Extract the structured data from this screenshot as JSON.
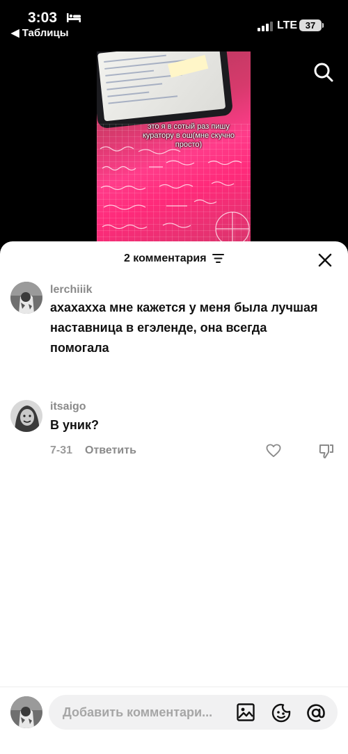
{
  "status_bar": {
    "time": "3:03",
    "back_app": "◀ Таблицы",
    "network": "LTE",
    "battery": "37"
  },
  "video": {
    "caption": "это я в сотый раз пишу куратору в ош(мне скучно просто)"
  },
  "comments_sheet": {
    "title": "2 комментария",
    "comments": [
      {
        "username": "lerchiiik",
        "text": "ахахахха мне кажется у меня была лучшая наставница в егэленде, она всегда помогала"
      },
      {
        "username": "itsaigo",
        "text": "В уник?",
        "date": "7-31",
        "reply_label": "Ответить"
      }
    ]
  },
  "composer": {
    "placeholder": "Добавить комментари..."
  },
  "colors": {
    "video_accent": "#ff3c8a",
    "sheet_bg": "#ffffff",
    "muted_text": "#8a8a8a"
  }
}
